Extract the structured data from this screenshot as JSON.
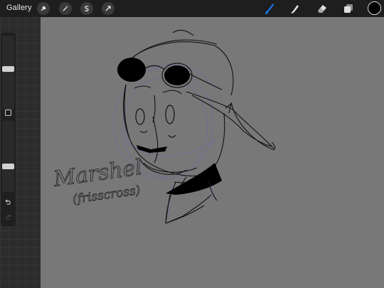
{
  "topbar": {
    "gallery_label": "Gallery",
    "actions": [
      {
        "name": "wrench-icon"
      },
      {
        "name": "magic-wand-icon"
      },
      {
        "name": "selection-s-icon"
      },
      {
        "name": "transform-arrow-icon"
      }
    ],
    "tools": [
      {
        "name": "brush-icon",
        "active": true,
        "color": "#1a73e8"
      },
      {
        "name": "smudge-icon",
        "active": false,
        "color": "#e0e0e0"
      },
      {
        "name": "eraser-icon",
        "active": false,
        "color": "#e0e0e0"
      },
      {
        "name": "layers-icon",
        "active": false,
        "color": "#e0e0e0"
      }
    ],
    "current_color": "#000000"
  },
  "sidebar": {
    "brush_size_level": 0.55,
    "opacity_level": 0.35,
    "icons": [
      "undo-icon",
      "redo-icon"
    ]
  },
  "canvas": {
    "background": "#787878",
    "sketch_text": "Marshel",
    "sketch_subtext": "(frisscross)"
  }
}
